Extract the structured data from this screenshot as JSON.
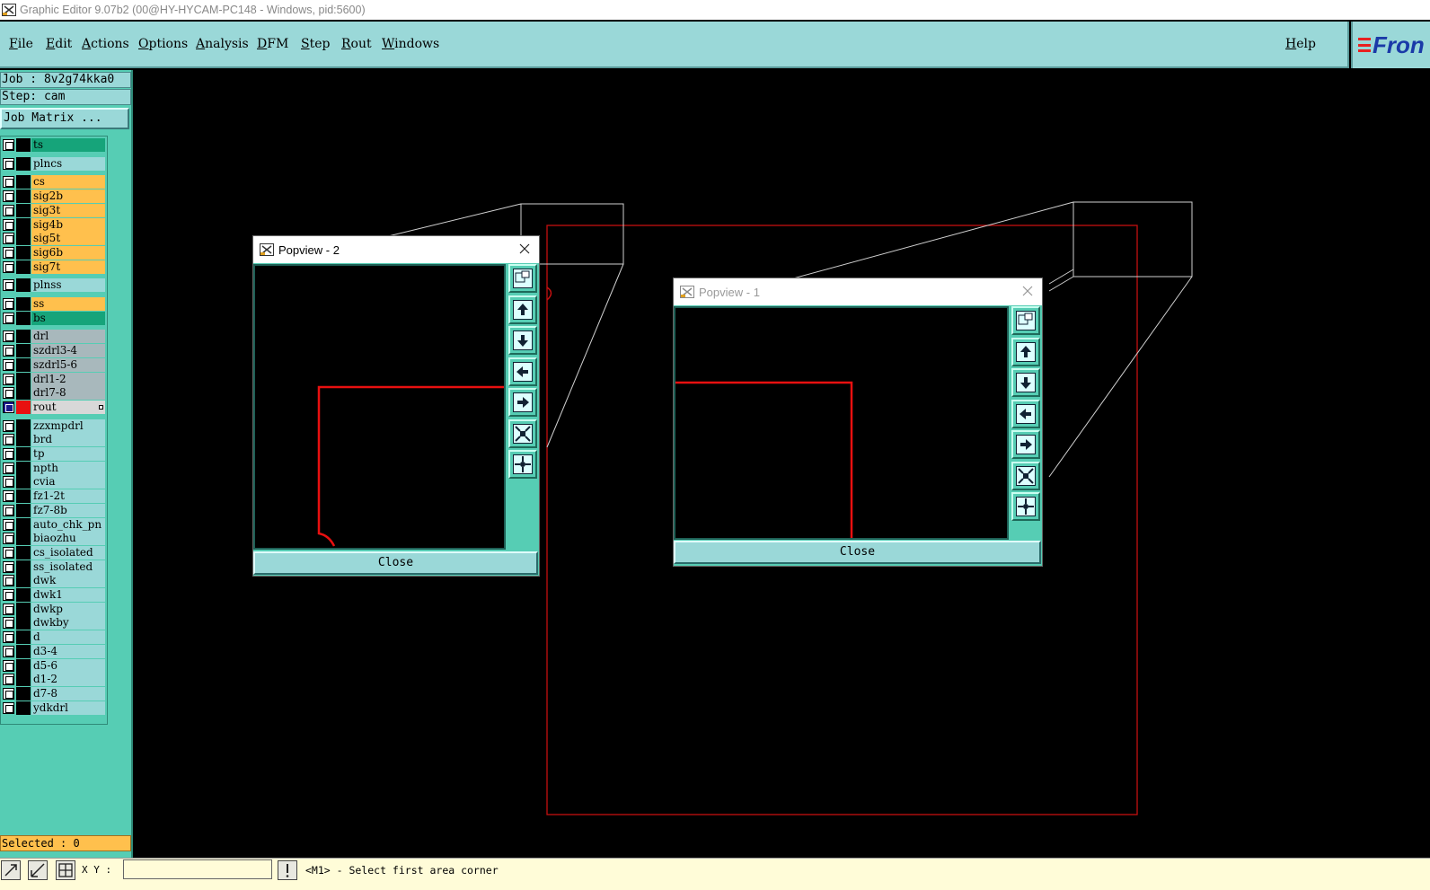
{
  "window": {
    "title": "Graphic Editor 9.07b2 (00@HY-HYCAM-PC148 - Windows, pid:5600)"
  },
  "menubar": {
    "items": [
      "File",
      "Edit",
      "Actions",
      "Options",
      "Analysis",
      "DFM",
      "Step",
      "Rout",
      "Windows"
    ],
    "help": "Help",
    "logo_text": "Fron"
  },
  "left_panel": {
    "job_line": "Job : 8v2g74kka0",
    "step_line": "Step: cam",
    "job_matrix_button": "Job Matrix ...",
    "selected_line": "Selected : 0",
    "layers": [
      {
        "name": "ts",
        "color": "#16a47a"
      },
      {
        "name": "plncs",
        "color": "#9ad8d8"
      },
      {
        "name": "cs",
        "color": "#ffc04d"
      },
      {
        "name": "sig2b",
        "color": "#ffc04d"
      },
      {
        "name": "sig3t",
        "color": "#ffc04d"
      },
      {
        "name": "sig4b",
        "color": "#ffc04d"
      },
      {
        "name": "sig5t",
        "color": "#ffc04d"
      },
      {
        "name": "sig6b",
        "color": "#ffc04d"
      },
      {
        "name": "sig7t",
        "color": "#ffc04d"
      },
      {
        "name": "plnss",
        "color": "#9ad8d8"
      },
      {
        "name": "ss",
        "color": "#ffc04d"
      },
      {
        "name": "bs",
        "color": "#16a47a"
      },
      {
        "name": "drl",
        "color": "#a8b8bc"
      },
      {
        "name": "szdrl3-4",
        "color": "#a8b8bc"
      },
      {
        "name": "szdrl5-6",
        "color": "#a8b8bc"
      },
      {
        "name": "drl1-2",
        "color": "#a8b8bc"
      },
      {
        "name": "drl7-8",
        "color": "#a8b8bc"
      },
      {
        "name": "rout",
        "color": "#d8d8d8",
        "active": true,
        "swatch": "#e81010"
      },
      {
        "name": "zzxmpdrl",
        "color": "#9ad8d8"
      },
      {
        "name": "brd",
        "color": "#9ad8d8"
      },
      {
        "name": "tp",
        "color": "#9ad8d8"
      },
      {
        "name": "npth",
        "color": "#9ad8d8"
      },
      {
        "name": "cvia",
        "color": "#9ad8d8"
      },
      {
        "name": "fz1-2t",
        "color": "#9ad8d8"
      },
      {
        "name": "fz7-8b",
        "color": "#9ad8d8"
      },
      {
        "name": "auto_chk_pn",
        "color": "#9ad8d8"
      },
      {
        "name": "biaozhu",
        "color": "#9ad8d8"
      },
      {
        "name": "cs_isolated",
        "color": "#9ad8d8"
      },
      {
        "name": "ss_isolated",
        "color": "#9ad8d8"
      },
      {
        "name": "dwk",
        "color": "#9ad8d8"
      },
      {
        "name": "dwk1",
        "color": "#9ad8d8"
      },
      {
        "name": "dwkp",
        "color": "#9ad8d8"
      },
      {
        "name": "dwkby",
        "color": "#9ad8d8"
      },
      {
        "name": "d",
        "color": "#9ad8d8"
      },
      {
        "name": "d3-4",
        "color": "#9ad8d8"
      },
      {
        "name": "d5-6",
        "color": "#9ad8d8"
      },
      {
        "name": "d1-2",
        "color": "#9ad8d8"
      },
      {
        "name": "d7-8",
        "color": "#9ad8d8"
      },
      {
        "name": "ydkdrl",
        "color": "#9ad8d8"
      }
    ]
  },
  "popviews": [
    {
      "title": "Popview - 2",
      "close_label": "Close",
      "active": true
    },
    {
      "title": "Popview - 1",
      "close_label": "Close",
      "active": false
    }
  ],
  "toolbar_icons": [
    "zoom-area-icon",
    "pan-up-icon",
    "pan-down-icon",
    "pan-left-icon",
    "pan-right-icon",
    "zoom-in-icon",
    "zoom-out-icon"
  ],
  "statusbar": {
    "xy_label": "X Y :",
    "xy_value": "",
    "message": "<M1> - Select first area corner"
  },
  "colors": {
    "accent_teal": "#56cdb4",
    "menu_bg": "#9ad8d8",
    "rout_red": "#e81010"
  }
}
